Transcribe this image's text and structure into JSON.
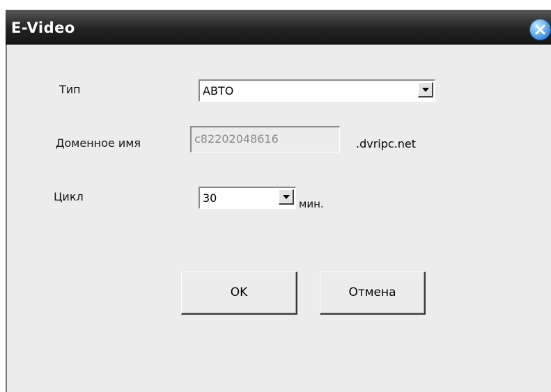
{
  "window": {
    "title": "E-Video"
  },
  "form": {
    "type": {
      "label": "Тип",
      "value": "АВТО"
    },
    "domain": {
      "label": "Доменное имя",
      "value": "c82202048616",
      "suffix": ".dvripc.net"
    },
    "cycle": {
      "label": "Цикл",
      "value": "30",
      "unit": "мин."
    }
  },
  "buttons": {
    "ok": "OK",
    "cancel": "Отмена"
  },
  "icons": {
    "close": "close-icon",
    "dropdown": "chevron-down-icon"
  },
  "colors": {
    "titlebar": "#1e1e1e",
    "dialog_bg": "#ececec",
    "close_button": "#3a8be0"
  }
}
